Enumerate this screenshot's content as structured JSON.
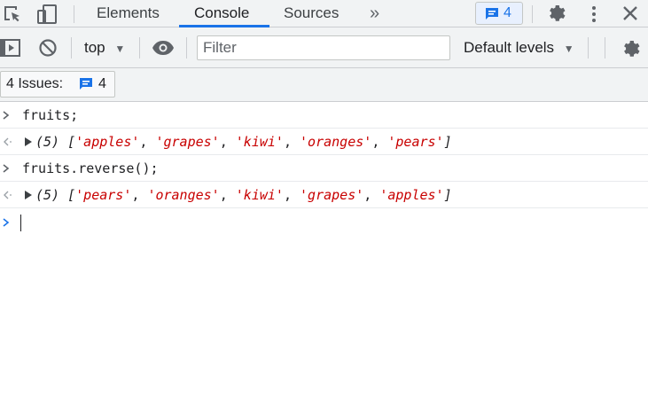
{
  "tabs": [
    {
      "label": "Elements"
    },
    {
      "label": "Console"
    },
    {
      "label": "Sources"
    }
  ],
  "top": {
    "more_tabs": "»",
    "issues_count": "4"
  },
  "toolbar": {
    "context": "top",
    "filter_placeholder": "Filter",
    "levels": "Default levels"
  },
  "issues": {
    "label": "4 Issues:",
    "count": "4"
  },
  "console": {
    "lines": [
      {
        "kind": "input",
        "text": "fruits;"
      },
      {
        "kind": "output",
        "count": "(5)",
        "items": [
          "'apples'",
          "'grapes'",
          "'kiwi'",
          "'oranges'",
          "'pears'"
        ]
      },
      {
        "kind": "input",
        "text": "fruits.reverse();"
      },
      {
        "kind": "output",
        "count": "(5)",
        "items": [
          "'pears'",
          "'oranges'",
          "'kiwi'",
          "'grapes'",
          "'apples'"
        ]
      }
    ]
  },
  "colors": {
    "accent": "#1a73e8",
    "string": "#c80000"
  }
}
